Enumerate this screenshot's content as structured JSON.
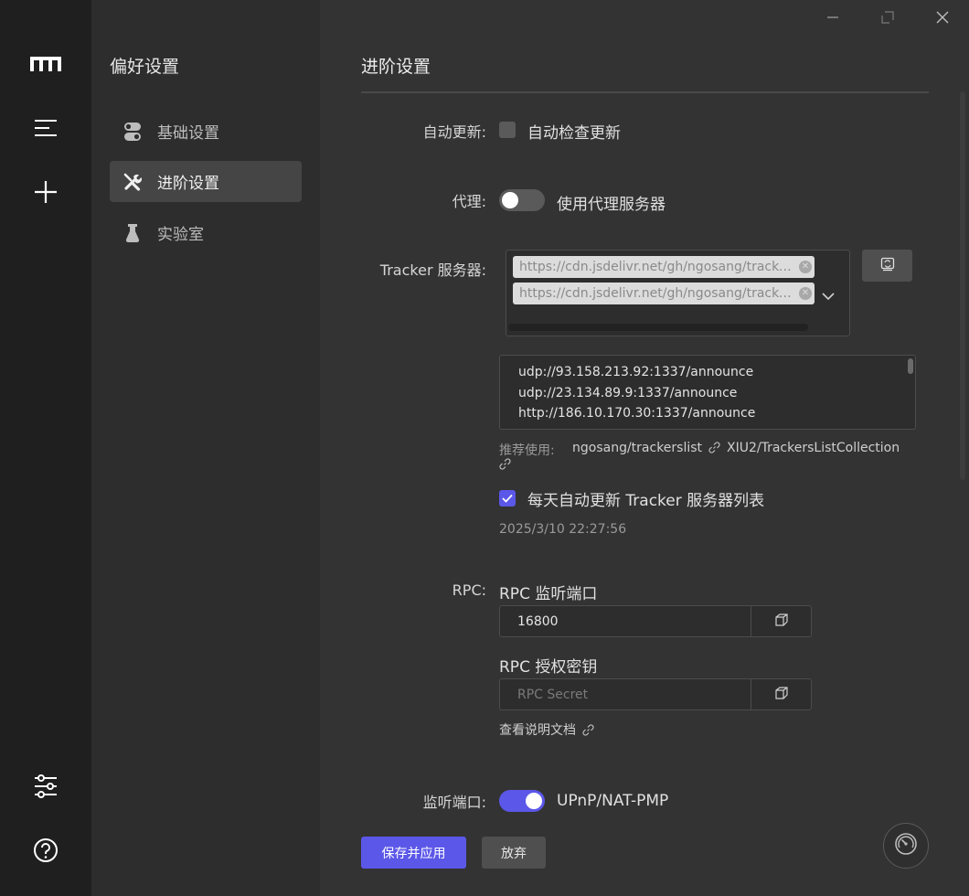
{
  "nav": {
    "title": "偏好设置",
    "items": [
      {
        "label": "基础设置",
        "icon": "toggles-icon"
      },
      {
        "label": "进阶设置",
        "icon": "tools-icon"
      },
      {
        "label": "实验室",
        "icon": "lab-flask-icon"
      }
    ],
    "active_index": 1
  },
  "page": {
    "title": "进阶设置"
  },
  "auto_update": {
    "label": "自动更新:",
    "checkbox_label": "自动检查更新",
    "checked": false
  },
  "proxy": {
    "label": "代理:",
    "toggle_label": "使用代理服务器",
    "enabled": false
  },
  "tracker": {
    "label": "Tracker 服务器:",
    "selected_sources": [
      "https://cdn.jsdelivr.net/gh/ngosang/trackerslist/trackers_best_ip.txt",
      "https://cdn.jsdelivr.net/gh/ngosang/trackerslist/trackers_best.txt"
    ],
    "list": [
      "udp://93.158.213.92:1337/announce",
      "udp://23.134.89.9:1337/announce",
      "http://186.10.170.30:1337/announce"
    ],
    "recommend_prefix": "推荐使用:",
    "recommend_links": [
      "ngosang/trackerslist",
      "XIU2/TrackersListCollection"
    ],
    "daily_update_label": "每天自动更新 Tracker 服务器列表",
    "daily_update_checked": true,
    "last_update": "2025/3/10 22:27:56"
  },
  "rpc": {
    "label": "RPC:",
    "port_label": "RPC 监听端口",
    "port_value": "16800",
    "secret_label": "RPC 授权密钥",
    "secret_placeholder": "RPC Secret",
    "secret_value": "",
    "docs_link": "查看说明文档"
  },
  "listen_port": {
    "label": "监听端口:",
    "toggle_label": "UPnP/NAT-PMP",
    "enabled": true
  },
  "actions": {
    "save": "保存并应用",
    "discard": "放弃"
  },
  "colors": {
    "accent": "#5b57e8",
    "rail_bg": "#1f1f1f",
    "nav_bg": "#2d2d2d",
    "main_bg": "#333333"
  }
}
